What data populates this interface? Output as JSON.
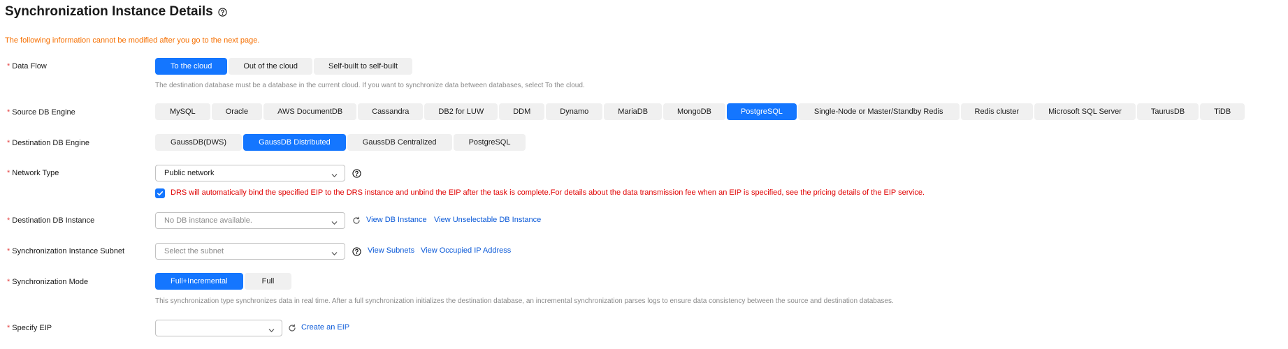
{
  "page": {
    "title": "Synchronization Instance Details",
    "notice": "The following information cannot be modified after you go to the next page."
  },
  "data_flow": {
    "label": "Data Flow",
    "options": [
      "To the cloud",
      "Out of the cloud",
      "Self-built to self-built"
    ],
    "selected": "To the cloud",
    "hint": "The destination database must be a database in the current cloud. If you want to synchronize data between databases, select To the cloud."
  },
  "source_engine": {
    "label": "Source DB Engine",
    "options": [
      "MySQL",
      "Oracle",
      "AWS DocumentDB",
      "Cassandra",
      "DB2 for LUW",
      "DDM",
      "Dynamo",
      "MariaDB",
      "MongoDB",
      "PostgreSQL",
      "Single-Node or Master/Standby Redis",
      "Redis cluster",
      "Microsoft SQL Server",
      "TaurusDB",
      "TiDB"
    ],
    "selected": "PostgreSQL"
  },
  "destination_engine": {
    "label": "Destination DB Engine",
    "options": [
      "GaussDB(DWS)",
      "GaussDB Distributed",
      "GaussDB Centralized",
      "PostgreSQL"
    ],
    "selected": "GaussDB Distributed"
  },
  "network_type": {
    "label": "Network Type",
    "value": "Public network",
    "checkbox_checked": true,
    "eip_note": "DRS will automatically bind the specified EIP to the DRS instance and unbind the EIP after the task is complete.For details about the data transmission fee when an EIP is specified, see the pricing details of the EIP service."
  },
  "destination_instance": {
    "label": "Destination DB Instance",
    "placeholder": "No DB instance available.",
    "link_view": "View DB Instance",
    "link_unselectable": "View Unselectable DB Instance"
  },
  "subnet": {
    "label": "Synchronization Instance Subnet",
    "placeholder": "Select the subnet",
    "link_view": "View Subnets",
    "link_occupied": "View Occupied IP Address"
  },
  "sync_mode": {
    "label": "Synchronization Mode",
    "options": [
      "Full+Incremental",
      "Full"
    ],
    "selected": "Full+Incremental",
    "hint": "This synchronization type synchronizes data in real time. After a full synchronization initializes the destination database, an incremental synchronization parses logs to ensure data consistency between the source and destination databases."
  },
  "specify_eip": {
    "label": "Specify EIP",
    "value": "",
    "link_create": "Create an EIP"
  },
  "colors": {
    "accent": "#1476ff",
    "link": "#0a59d8",
    "required": "#e54545",
    "warning": "#f66f00",
    "error": "#e00000"
  }
}
